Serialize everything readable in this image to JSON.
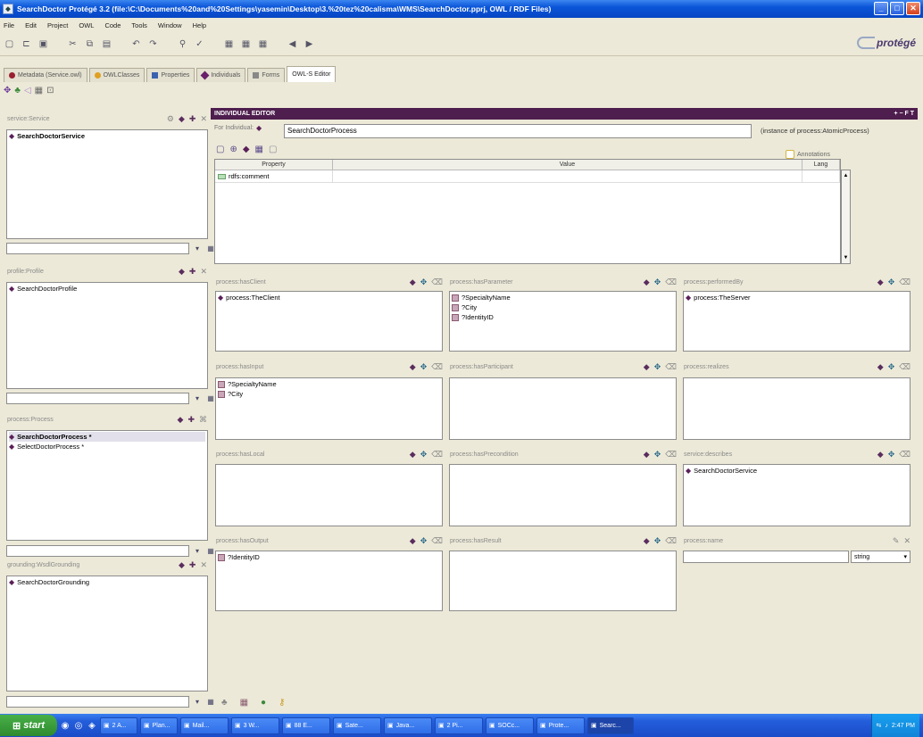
{
  "window": {
    "title": "SearchDoctor Protégé 3.2   (file:\\C:\\Documents%20and%20Settings\\yasemin\\Desktop\\3.%20tez%20calisma\\WMS\\SearchDoctor.pprj, OWL / RDF Files)",
    "min": "_",
    "max": "□",
    "close": "✕"
  },
  "menu": [
    "File",
    "Edit",
    "Project",
    "OWL",
    "Code",
    "Tools",
    "Window",
    "Help"
  ],
  "logo": "protégé",
  "tabs": [
    {
      "label": "Metadata (Service.owl)",
      "color": "#9a1f2f"
    },
    {
      "label": "OWLClasses",
      "color": "#e0a020"
    },
    {
      "label": "Properties",
      "color": "#3a62b0"
    },
    {
      "label": "Individuals",
      "color": "#6a1f6a"
    },
    {
      "label": "Forms",
      "color": "#888888"
    },
    {
      "label": "OWL-S Editor",
      "color": ""
    }
  ],
  "left": {
    "service": {
      "title": "service:Service",
      "items": [
        {
          "label": "SearchDoctorService"
        }
      ]
    },
    "profile": {
      "title": "profile:Profile",
      "items": [
        {
          "label": "SearchDoctorProfile"
        }
      ]
    },
    "process": {
      "title": "process:Process",
      "items": [
        {
          "label": "SearchDoctorProcess *",
          "selected": true
        },
        {
          "label": "SelectDoctorProcess *"
        }
      ]
    },
    "grounding": {
      "title": "grounding:WsdlGrounding",
      "items": [
        {
          "label": "SearchDoctorGrounding"
        }
      ]
    }
  },
  "editor": {
    "header": "INDIVIDUAL EDITOR",
    "header_actions": "+ − F T",
    "for_individual_label": "For Individual:",
    "individual_name": "SearchDoctorProcess",
    "instance_of": "(instance of process:AtomicProcess)",
    "annotations_label": "Annotations",
    "table": {
      "headers": [
        "Property",
        "Value",
        "Lang"
      ],
      "rows": [
        {
          "property": "rdfs:comment",
          "value": "",
          "lang": ""
        }
      ]
    }
  },
  "grid": [
    {
      "id": "hasClient",
      "title": "process:hasClient",
      "items": [
        {
          "label": "process:TheClient",
          "kind": "ind"
        }
      ]
    },
    {
      "id": "hasParameter",
      "title": "process:hasParameter",
      "items": [
        {
          "label": "?SpecialtyName",
          "kind": "param"
        },
        {
          "label": "?City",
          "kind": "param"
        },
        {
          "label": "?IdentityID",
          "kind": "param"
        }
      ]
    },
    {
      "id": "performedBy",
      "title": "process:performedBy",
      "items": [
        {
          "label": "process:TheServer",
          "kind": "ind"
        }
      ]
    },
    {
      "id": "hasInput",
      "title": "process:hasInput",
      "items": [
        {
          "label": "?SpecialtyName",
          "kind": "param"
        },
        {
          "label": "?City",
          "kind": "param"
        }
      ]
    },
    {
      "id": "hasParticipant",
      "title": "process:hasParticipant",
      "items": []
    },
    {
      "id": "realizes",
      "title": "process:realizes",
      "items": []
    },
    {
      "id": "hasLocal",
      "title": "process:hasLocal",
      "items": []
    },
    {
      "id": "hasPrecondition",
      "title": "process:hasPrecondition",
      "items": []
    },
    {
      "id": "describes",
      "title": "service:describes",
      "items": [
        {
          "label": "SearchDoctorService",
          "kind": "ind"
        }
      ]
    },
    {
      "id": "hasOutput",
      "title": "process:hasOutput",
      "items": [
        {
          "label": "?IdentityID",
          "kind": "param"
        }
      ]
    },
    {
      "id": "hasResult",
      "title": "process:hasResult",
      "items": []
    }
  ],
  "process_name": {
    "title": "process:name",
    "type": "string"
  },
  "taskbar": {
    "start": "start",
    "tasks": [
      "2 A...",
      "Plan...",
      "Mail...",
      "3 W...",
      "88 E...",
      "Sate...",
      "Java...",
      "2 Pi...",
      "SOCc...",
      "Prote...",
      "Searc..."
    ],
    "active_task": 10,
    "clock": "2:47 PM"
  }
}
